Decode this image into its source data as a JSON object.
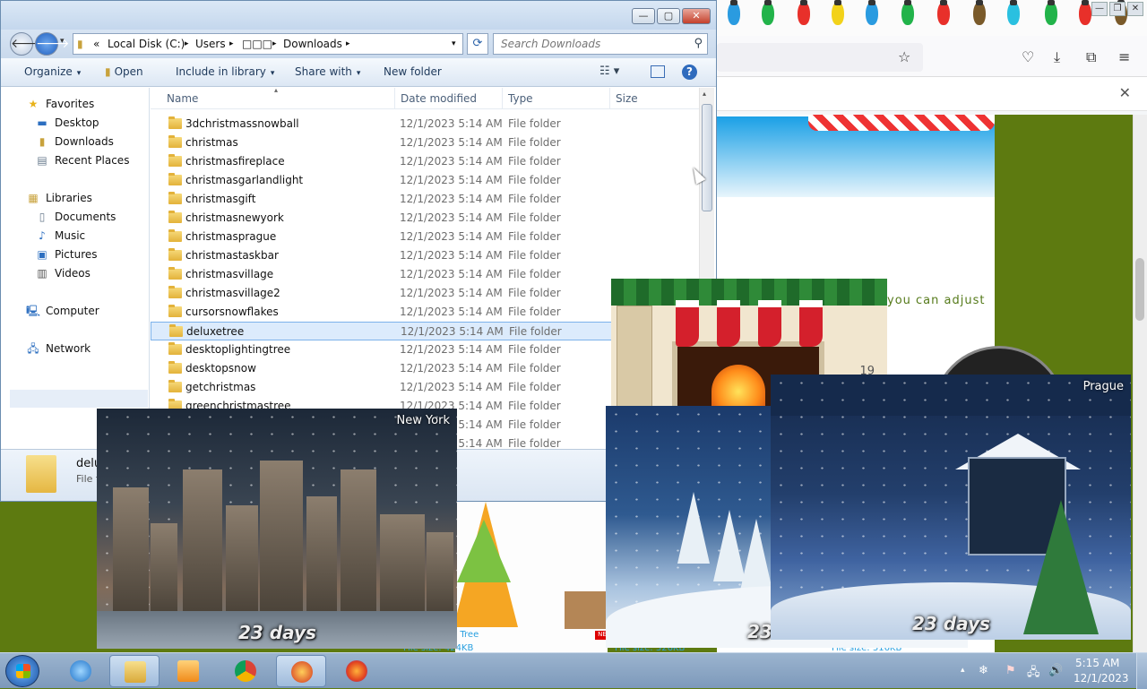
{
  "explorer": {
    "window_buttons": {
      "minimize": "—",
      "maximize": "▢",
      "close": "✕"
    },
    "address": {
      "prefix": "«",
      "segments": [
        "Local Disk (C:)",
        "Users",
        "□□□",
        "Downloads"
      ],
      "separator": "▸"
    },
    "search": {
      "placeholder": "Search Downloads"
    },
    "commands": {
      "organize": "Organize",
      "open": "Open",
      "include_in_library": "Include in library",
      "share_with": "Share with",
      "new_folder": "New folder"
    },
    "nav": {
      "favorites": "Favorites",
      "desktop": "Desktop",
      "downloads": "Downloads",
      "recent_places": "Recent Places",
      "libraries": "Libraries",
      "documents": "Documents",
      "music": "Music",
      "pictures": "Pictures",
      "videos": "Videos",
      "computer": "Computer",
      "network": "Network"
    },
    "columns": {
      "name": "Name",
      "date": "Date modified",
      "type": "Type",
      "size": "Size"
    },
    "rows": [
      {
        "name": "3dchristmassnowball",
        "date": "12/1/2023 5:14 AM",
        "type": "File folder"
      },
      {
        "name": "christmas",
        "date": "12/1/2023 5:14 AM",
        "type": "File folder"
      },
      {
        "name": "christmasfireplace",
        "date": "12/1/2023 5:14 AM",
        "type": "File folder"
      },
      {
        "name": "christmasgarlandlight",
        "date": "12/1/2023 5:14 AM",
        "type": "File folder"
      },
      {
        "name": "christmasgift",
        "date": "12/1/2023 5:14 AM",
        "type": "File folder"
      },
      {
        "name": "christmasnewyork",
        "date": "12/1/2023 5:14 AM",
        "type": "File folder"
      },
      {
        "name": "christmasprague",
        "date": "12/1/2023 5:14 AM",
        "type": "File folder"
      },
      {
        "name": "christmastaskbar",
        "date": "12/1/2023 5:14 AM",
        "type": "File folder"
      },
      {
        "name": "christmasvillage",
        "date": "12/1/2023 5:14 AM",
        "type": "File folder"
      },
      {
        "name": "christmasvillage2",
        "date": "12/1/2023 5:14 AM",
        "type": "File folder"
      },
      {
        "name": "cursorsnowflakes",
        "date": "12/1/2023 5:14 AM",
        "type": "File folder"
      },
      {
        "name": "deluxetree",
        "date": "12/1/2023 5:14 AM",
        "type": "File folder"
      },
      {
        "name": "desktoplightingtree",
        "date": "12/1/2023 5:14 AM",
        "type": "File folder"
      },
      {
        "name": "desktopsnow",
        "date": "12/1/2023 5:14 AM",
        "type": "File folder"
      },
      {
        "name": "getchristmas",
        "date": "12/1/2023 5:14 AM",
        "type": "File folder"
      },
      {
        "name": "greenchristmastree",
        "date": "12/1/2023 5:14 AM",
        "type": "File folder"
      },
      {
        "name": "",
        "date": "12/1/2023 5:14 AM",
        "type": "File folder"
      },
      {
        "name": "",
        "date": "12/1/2023 5:14 AM",
        "type": "File folder"
      }
    ],
    "selected_row": 11,
    "details": {
      "name": "delu",
      "type": "File f"
    }
  },
  "browser": {
    "page_text": "you  can  adjust",
    "captions": {
      "tree": "stmas Tree",
      "size1": "File size: 424KB",
      "size2": "File size: 326KB",
      "size3": "File size: 316KB",
      "ne": "NE"
    }
  },
  "previews": {
    "newyork": {
      "label": "New York",
      "days": "23 days"
    },
    "fireplace": {
      "time": "19"
    },
    "snow": {
      "days": "23"
    },
    "prague": {
      "label": "Prague",
      "days": "23 days"
    }
  },
  "taskbar": {
    "clock_time": "5:15 AM",
    "clock_date": "12/1/2023"
  },
  "icons": {
    "up_chevron": "▴",
    "down": "▾"
  },
  "colors": {
    "explorer_frame": "#6b8db0",
    "selection": "#dcebfc",
    "desktop_green": "#5d7a10"
  }
}
